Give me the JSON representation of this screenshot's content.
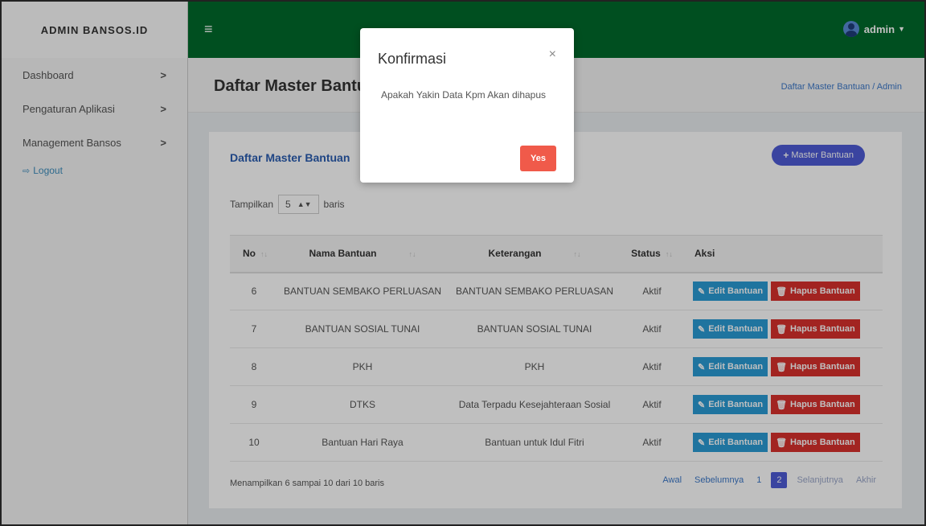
{
  "brand": "ADMIN BANSOS.ID",
  "sidebar": {
    "items": [
      {
        "label": "Dashboard",
        "chev": ">"
      },
      {
        "label": "Pengaturan Aplikasi",
        "chev": ">"
      },
      {
        "label": "Management Bansos",
        "chev": ">"
      }
    ],
    "logout": "Logout"
  },
  "topbar": {
    "menu_icon": "≡",
    "user": "admin"
  },
  "page": {
    "title": "Daftar Master Bantuan",
    "breadcrumb": "Daftar Master Bantuan / Admin"
  },
  "card": {
    "title": "Daftar Master Bantuan",
    "add_button": "Master Bantuan",
    "show_prefix": "Tampilkan",
    "show_value": "5",
    "show_suffix": "baris"
  },
  "table": {
    "headers": [
      "No",
      "Nama Bantuan",
      "Keterangan",
      "Status",
      "Aksi"
    ],
    "rows": [
      {
        "no": "6",
        "nama": "BANTUAN SEMBAKO PERLUASAN",
        "ket": "BANTUAN SEMBAKO PERLUASAN",
        "status": "Aktif"
      },
      {
        "no": "7",
        "nama": "BANTUAN SOSIAL TUNAI",
        "ket": "BANTUAN SOSIAL TUNAI",
        "status": "Aktif"
      },
      {
        "no": "8",
        "nama": "PKH",
        "ket": "PKH",
        "status": "Aktif"
      },
      {
        "no": "9",
        "nama": "DTKS",
        "ket": "Data Terpadu Kesejahteraan Sosial",
        "status": "Aktif"
      },
      {
        "no": "10",
        "nama": "Bantuan Hari Raya",
        "ket": "Bantuan untuk Idul Fitri",
        "status": "Aktif"
      }
    ],
    "edit_label": "Edit Bantuan",
    "delete_label": "Hapus Bantuan"
  },
  "footer": {
    "info": "Menampilkan 6 sampai 10 dari 10 baris"
  },
  "pager": {
    "first": "Awal",
    "prev": "Sebelumnya",
    "page1": "1",
    "page2": "2",
    "next": "Selanjutnya",
    "last": "Akhir"
  },
  "modal": {
    "title": "Konfirmasi",
    "close": "×",
    "body": "Apakah Yakin Data Kpm Akan dihapus",
    "yes": "Yes"
  },
  "colors": {
    "topbar": "#006a2b",
    "accent": "#4e5bd6",
    "edit": "#2a9bd4",
    "delete": "#d9302c",
    "yes": "#f05a4a"
  }
}
